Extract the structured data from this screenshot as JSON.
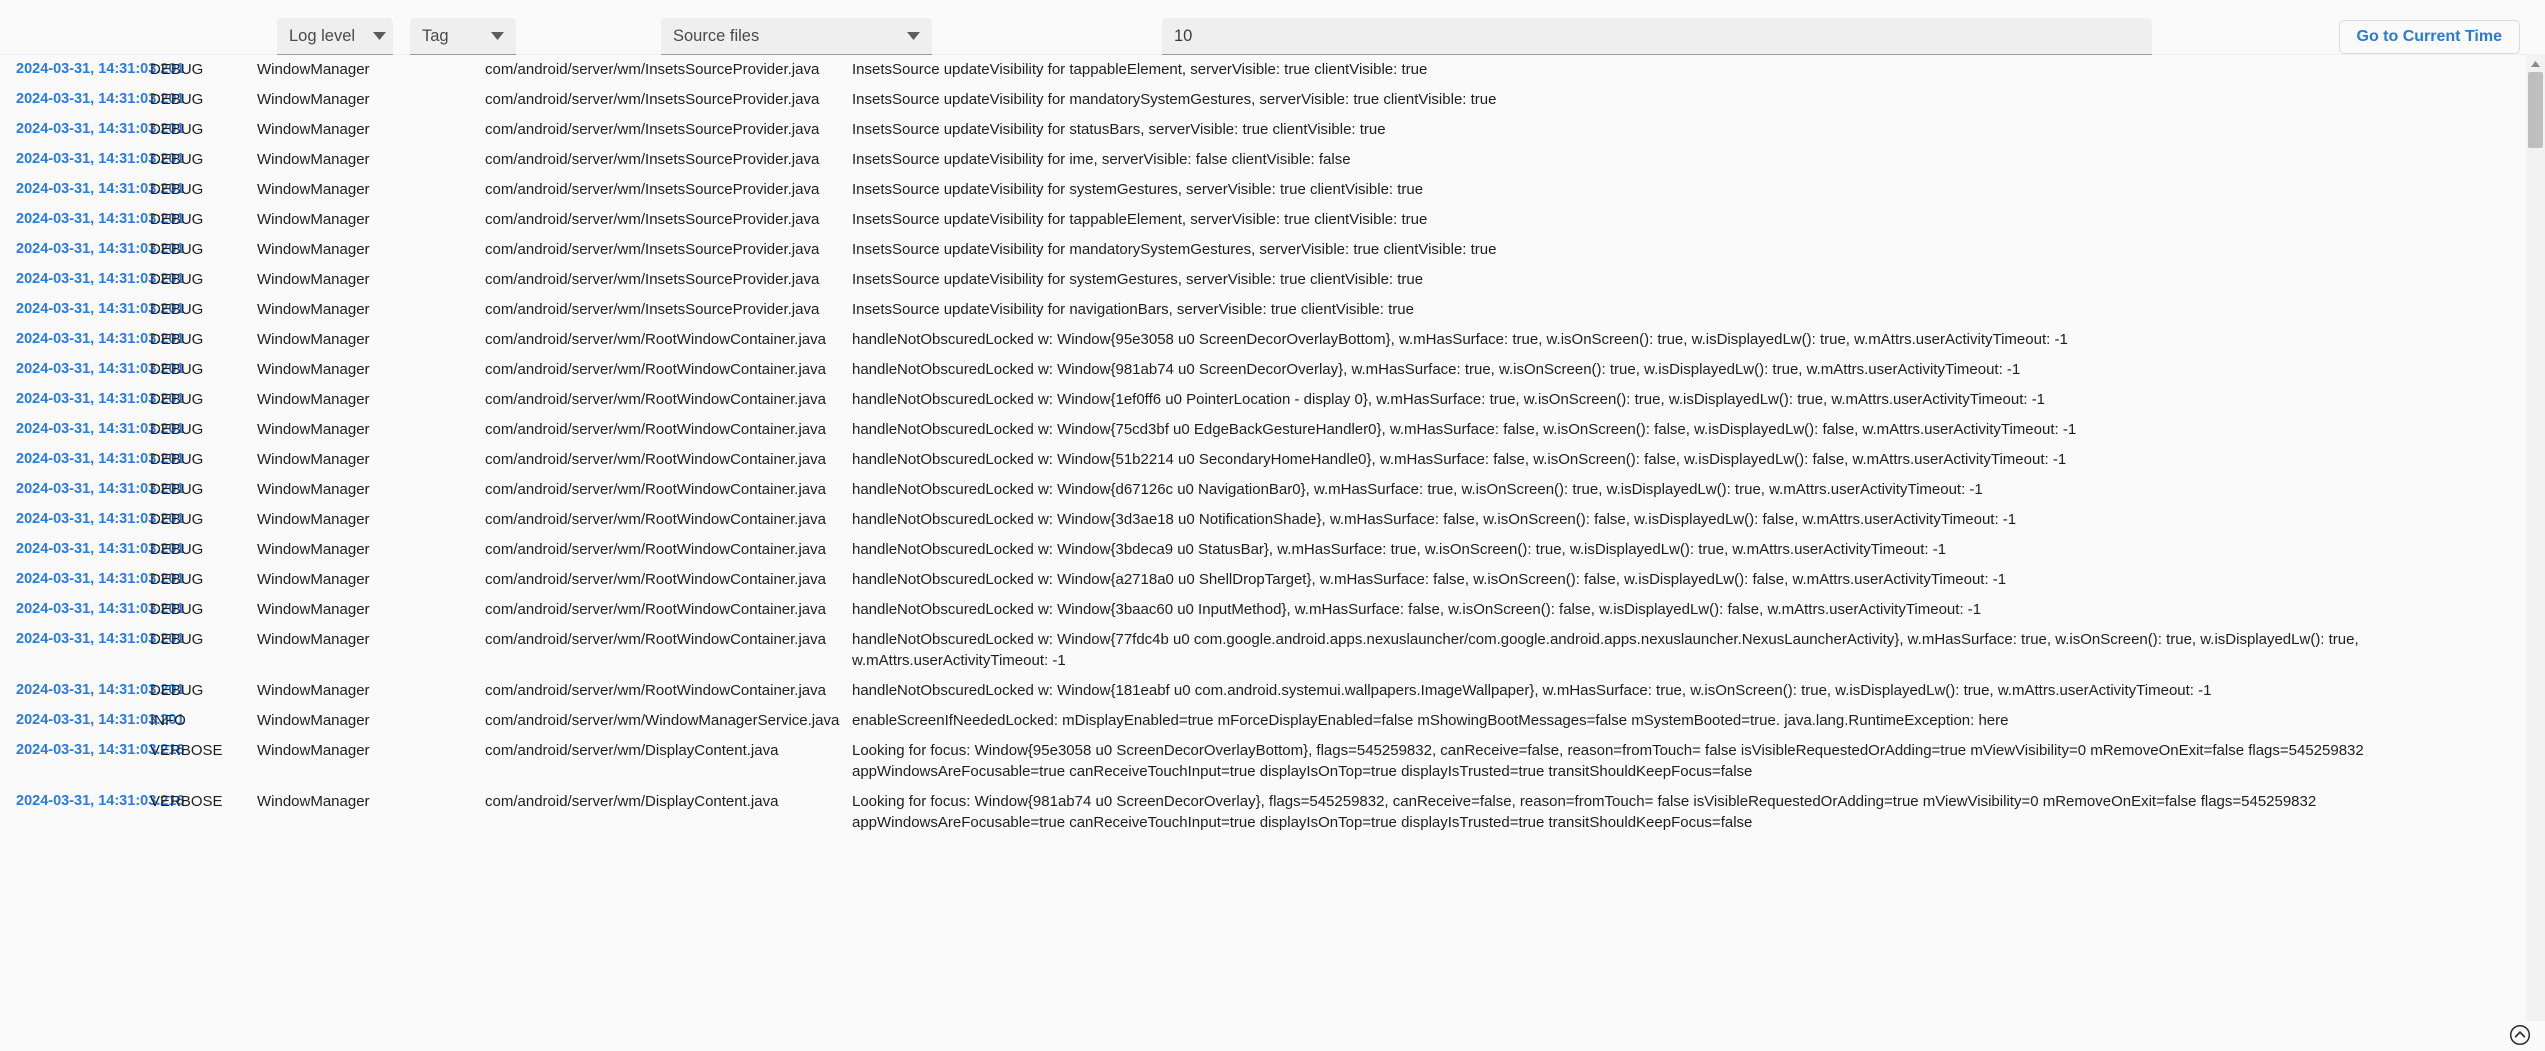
{
  "toolbar": {
    "filters": [
      {
        "name": "log-level",
        "label": "Log level",
        "icon": "chevron-down-icon"
      },
      {
        "name": "tag",
        "label": "Tag",
        "icon": "chevron-down-icon"
      },
      {
        "name": "source-files",
        "label": "Source files",
        "icon": "chevron-down-icon"
      }
    ],
    "search": {
      "value": "10",
      "placeholder": ""
    },
    "go_to_current_time_label": "Go to Current Time",
    "accent_color": "#2979d8"
  },
  "scrollbar": {
    "up_arrow_icon": "triangle-up-icon",
    "scroll_to_top_icon": "chevron-up-circle-icon"
  },
  "table": {
    "columns": [
      "timestamp",
      "level",
      "tag",
      "source",
      "message"
    ],
    "rows": [
      {
        "timestamp": "2024-03-31, 14:31:03.201",
        "level": "DEBUG",
        "tag": "WindowManager",
        "source": "com/android/server/wm/InsetsSourceProvider.java",
        "message": "InsetsSource updateVisibility for tappableElement, serverVisible: true clientVisible: true"
      },
      {
        "timestamp": "2024-03-31, 14:31:03.201",
        "level": "DEBUG",
        "tag": "WindowManager",
        "source": "com/android/server/wm/InsetsSourceProvider.java",
        "message": "InsetsSource updateVisibility for mandatorySystemGestures, serverVisible: true clientVisible: true"
      },
      {
        "timestamp": "2024-03-31, 14:31:03.201",
        "level": "DEBUG",
        "tag": "WindowManager",
        "source": "com/android/server/wm/InsetsSourceProvider.java",
        "message": "InsetsSource updateVisibility for statusBars, serverVisible: true clientVisible: true"
      },
      {
        "timestamp": "2024-03-31, 14:31:03.201",
        "level": "DEBUG",
        "tag": "WindowManager",
        "source": "com/android/server/wm/InsetsSourceProvider.java",
        "message": "InsetsSource updateVisibility for ime, serverVisible: false clientVisible: false"
      },
      {
        "timestamp": "2024-03-31, 14:31:03.201",
        "level": "DEBUG",
        "tag": "WindowManager",
        "source": "com/android/server/wm/InsetsSourceProvider.java",
        "message": "InsetsSource updateVisibility for systemGestures, serverVisible: true clientVisible: true"
      },
      {
        "timestamp": "2024-03-31, 14:31:03.201",
        "level": "DEBUG",
        "tag": "WindowManager",
        "source": "com/android/server/wm/InsetsSourceProvider.java",
        "message": "InsetsSource updateVisibility for tappableElement, serverVisible: true clientVisible: true"
      },
      {
        "timestamp": "2024-03-31, 14:31:03.201",
        "level": "DEBUG",
        "tag": "WindowManager",
        "source": "com/android/server/wm/InsetsSourceProvider.java",
        "message": "InsetsSource updateVisibility for mandatorySystemGestures, serverVisible: true clientVisible: true"
      },
      {
        "timestamp": "2024-03-31, 14:31:03.201",
        "level": "DEBUG",
        "tag": "WindowManager",
        "source": "com/android/server/wm/InsetsSourceProvider.java",
        "message": "InsetsSource updateVisibility for systemGestures, serverVisible: true clientVisible: true"
      },
      {
        "timestamp": "2024-03-31, 14:31:03.201",
        "level": "DEBUG",
        "tag": "WindowManager",
        "source": "com/android/server/wm/InsetsSourceProvider.java",
        "message": "InsetsSource updateVisibility for navigationBars, serverVisible: true clientVisible: true"
      },
      {
        "timestamp": "2024-03-31, 14:31:03.201",
        "level": "DEBUG",
        "tag": "WindowManager",
        "source": "com/android/server/wm/RootWindowContainer.java",
        "message": "handleNotObscuredLocked w: Window{95e3058 u0 ScreenDecorOverlayBottom}, w.mHasSurface: true, w.isOnScreen(): true, w.isDisplayedLw(): true, w.mAttrs.userActivityTimeout: -1"
      },
      {
        "timestamp": "2024-03-31, 14:31:03.201",
        "level": "DEBUG",
        "tag": "WindowManager",
        "source": "com/android/server/wm/RootWindowContainer.java",
        "message": "handleNotObscuredLocked w: Window{981ab74 u0 ScreenDecorOverlay}, w.mHasSurface: true, w.isOnScreen(): true, w.isDisplayedLw(): true, w.mAttrs.userActivityTimeout: -1"
      },
      {
        "timestamp": "2024-03-31, 14:31:03.201",
        "level": "DEBUG",
        "tag": "WindowManager",
        "source": "com/android/server/wm/RootWindowContainer.java",
        "message": "handleNotObscuredLocked w: Window{1ef0ff6 u0 PointerLocation - display 0}, w.mHasSurface: true, w.isOnScreen(): true, w.isDisplayedLw(): true, w.mAttrs.userActivityTimeout: -1"
      },
      {
        "timestamp": "2024-03-31, 14:31:03.201",
        "level": "DEBUG",
        "tag": "WindowManager",
        "source": "com/android/server/wm/RootWindowContainer.java",
        "message": "handleNotObscuredLocked w: Window{75cd3bf u0 EdgeBackGestureHandler0}, w.mHasSurface: false, w.isOnScreen(): false, w.isDisplayedLw(): false, w.mAttrs.userActivityTimeout: -1"
      },
      {
        "timestamp": "2024-03-31, 14:31:03.201",
        "level": "DEBUG",
        "tag": "WindowManager",
        "source": "com/android/server/wm/RootWindowContainer.java",
        "message": "handleNotObscuredLocked w: Window{51b2214 u0 SecondaryHomeHandle0}, w.mHasSurface: false, w.isOnScreen(): false, w.isDisplayedLw(): false, w.mAttrs.userActivityTimeout: -1"
      },
      {
        "timestamp": "2024-03-31, 14:31:03.201",
        "level": "DEBUG",
        "tag": "WindowManager",
        "source": "com/android/server/wm/RootWindowContainer.java",
        "message": "handleNotObscuredLocked w: Window{d67126c u0 NavigationBar0}, w.mHasSurface: true, w.isOnScreen(): true, w.isDisplayedLw(): true, w.mAttrs.userActivityTimeout: -1"
      },
      {
        "timestamp": "2024-03-31, 14:31:03.201",
        "level": "DEBUG",
        "tag": "WindowManager",
        "source": "com/android/server/wm/RootWindowContainer.java",
        "message": "handleNotObscuredLocked w: Window{3d3ae18 u0 NotificationShade}, w.mHasSurface: false, w.isOnScreen(): false, w.isDisplayedLw(): false, w.mAttrs.userActivityTimeout: -1"
      },
      {
        "timestamp": "2024-03-31, 14:31:03.201",
        "level": "DEBUG",
        "tag": "WindowManager",
        "source": "com/android/server/wm/RootWindowContainer.java",
        "message": "handleNotObscuredLocked w: Window{3bdeca9 u0 StatusBar}, w.mHasSurface: true, w.isOnScreen(): true, w.isDisplayedLw(): true, w.mAttrs.userActivityTimeout: -1"
      },
      {
        "timestamp": "2024-03-31, 14:31:03.201",
        "level": "DEBUG",
        "tag": "WindowManager",
        "source": "com/android/server/wm/RootWindowContainer.java",
        "message": "handleNotObscuredLocked w: Window{a2718a0 u0 ShellDropTarget}, w.mHasSurface: false, w.isOnScreen(): false, w.isDisplayedLw(): false, w.mAttrs.userActivityTimeout: -1"
      },
      {
        "timestamp": "2024-03-31, 14:31:03.201",
        "level": "DEBUG",
        "tag": "WindowManager",
        "source": "com/android/server/wm/RootWindowContainer.java",
        "message": "handleNotObscuredLocked w: Window{3baac60 u0 InputMethod}, w.mHasSurface: false, w.isOnScreen(): false, w.isDisplayedLw(): false, w.mAttrs.userActivityTimeout: -1"
      },
      {
        "timestamp": "2024-03-31, 14:31:03.201",
        "level": "DEBUG",
        "tag": "WindowManager",
        "source": "com/android/server/wm/RootWindowContainer.java",
        "message": "handleNotObscuredLocked w: Window{77fdc4b u0 com.google.android.apps.nexuslauncher/com.google.android.apps.nexuslauncher.NexusLauncherActivity}, w.mHasSurface: true, w.isOnScreen(): true, w.isDisplayedLw(): true, w.mAttrs.userActivityTimeout: -1"
      },
      {
        "timestamp": "2024-03-31, 14:31:03.201",
        "level": "DEBUG",
        "tag": "WindowManager",
        "source": "com/android/server/wm/RootWindowContainer.java",
        "message": "handleNotObscuredLocked w: Window{181eabf u0 com.android.systemui.wallpapers.ImageWallpaper}, w.mHasSurface: true, w.isOnScreen(): true, w.isDisplayedLw(): true, w.mAttrs.userActivityTimeout: -1"
      },
      {
        "timestamp": "2024-03-31, 14:31:03.201",
        "level": "INFO",
        "tag": "WindowManager",
        "source": "com/android/server/wm/WindowManagerService.java",
        "message": "enableScreenIfNeededLocked: mDisplayEnabled=true mForceDisplayEnabled=false mShowingBootMessages=false mSystemBooted=true. java.lang.RuntimeException: here"
      },
      {
        "timestamp": "2024-03-31, 14:31:03.216",
        "level": "VERBOSE",
        "tag": "WindowManager",
        "source": "com/android/server/wm/DisplayContent.java",
        "message": "Looking for focus: Window{95e3058 u0 ScreenDecorOverlayBottom}, flags=545259832, canReceive=false, reason=fromTouch= false isVisibleRequestedOrAdding=true mViewVisibility=0 mRemoveOnExit=false flags=545259832 appWindowsAreFocusable=true canReceiveTouchInput=true displayIsOnTop=true displayIsTrusted=true transitShouldKeepFocus=false"
      },
      {
        "timestamp": "2024-03-31, 14:31:03.216",
        "level": "VERBOSE",
        "tag": "WindowManager",
        "source": "com/android/server/wm/DisplayContent.java",
        "message": "Looking for focus: Window{981ab74 u0 ScreenDecorOverlay}, flags=545259832, canReceive=false, reason=fromTouch= false isVisibleRequestedOrAdding=true mViewVisibility=0 mRemoveOnExit=false flags=545259832 appWindowsAreFocusable=true canReceiveTouchInput=true displayIsOnTop=true displayIsTrusted=true transitShouldKeepFocus=false"
      }
    ]
  }
}
